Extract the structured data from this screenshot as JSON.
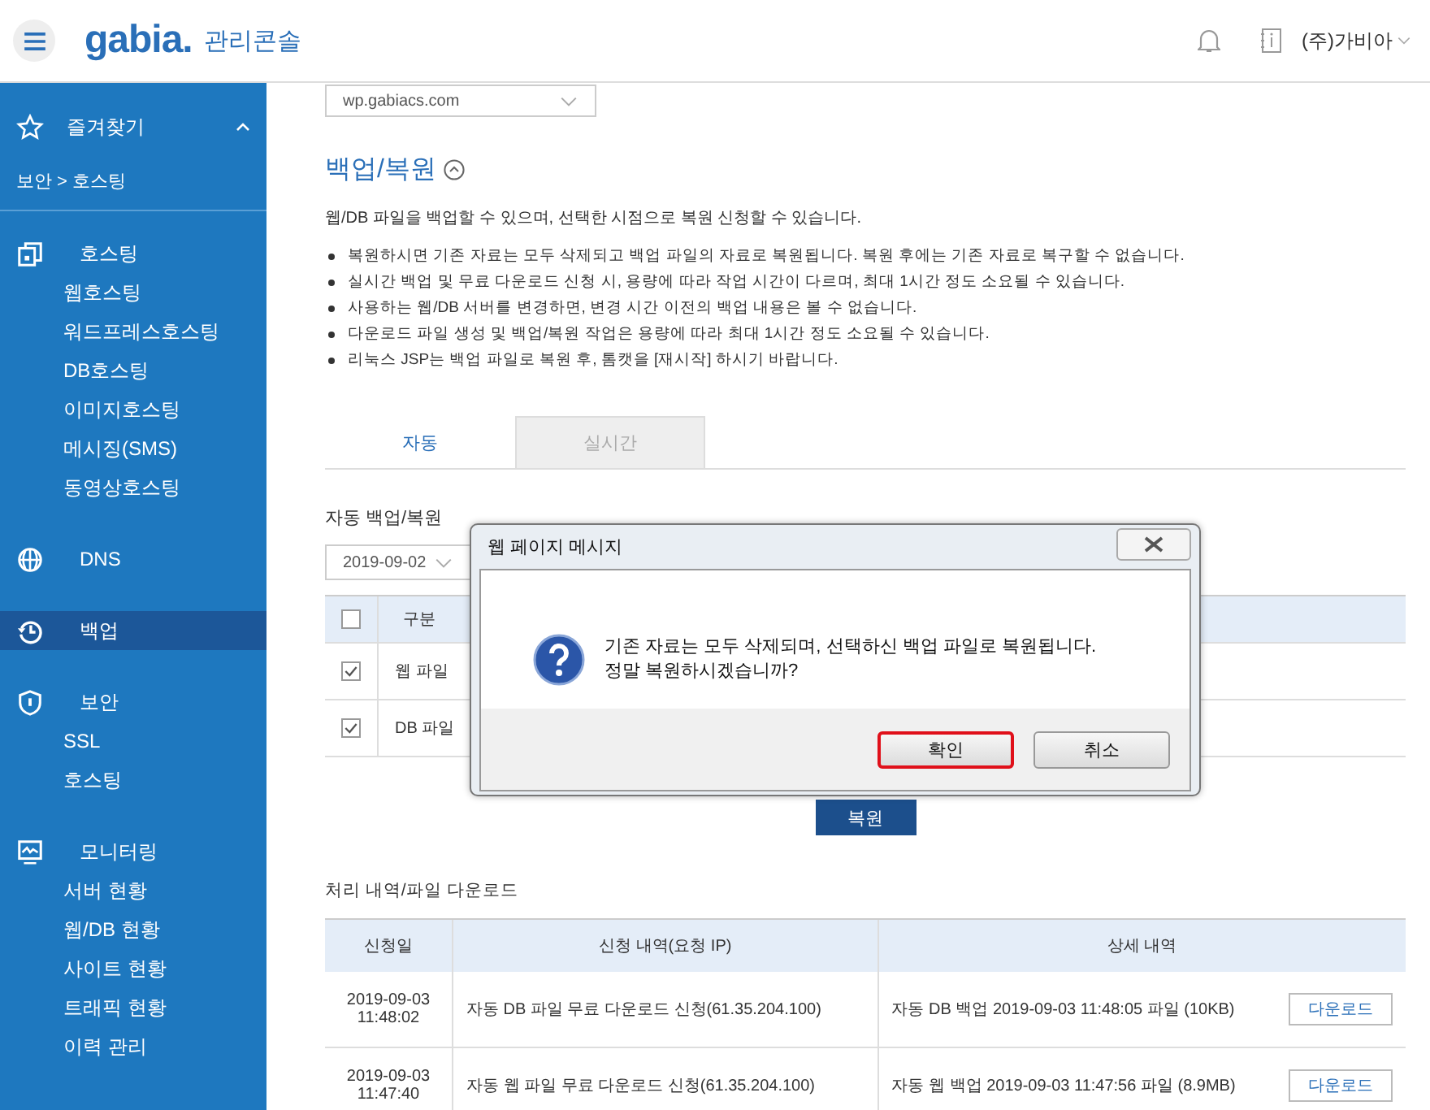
{
  "header": {
    "logo": "gabia.",
    "title": "관리콘솔",
    "account": "(주)가비아"
  },
  "sidebar": {
    "favorites": {
      "label": "즐겨찾기",
      "expanded": true
    },
    "breadcrumb": "보안 > 호스팅",
    "groups": [
      {
        "kind": "hosting",
        "label": "호스팅",
        "selected": false,
        "items": [
          "웹호스팅",
          "워드프레스호스팅",
          "DB호스팅",
          "이미지호스팅",
          "메시징(SMS)",
          "동영상호스팅"
        ]
      },
      {
        "kind": "dns",
        "label": "DNS",
        "selected": false
      },
      {
        "kind": "backup",
        "label": "백업",
        "selected": true
      },
      {
        "kind": "security",
        "label": "보안",
        "selected": false,
        "items": [
          "SSL",
          "호스팅"
        ]
      },
      {
        "kind": "monitoring",
        "label": "모니터링",
        "selected": false,
        "items": [
          "서버 현황",
          "웹/DB 현황",
          "사이트 현황",
          "트래픽 현황",
          "이력 관리"
        ]
      }
    ]
  },
  "main": {
    "domain_select": "wp.gabiacs.com",
    "title": "백업/복원",
    "intro": "웹/DB 파일을 백업할 수 있으며, 선택한 시점으로 복원 신청할 수 있습니다.",
    "notes": [
      "복원하시면 기존 자료는 모두 삭제되고 백업 파일의 자료로 복원됩니다. 복원 후에는 기존 자료로 복구할 수 없습니다.",
      "실시간 백업 및 무료 다운로드 신청 시, 용량에 따라 작업 시간이 다르며, 최대 1시간 정도 소요될 수 있습니다.",
      "사용하는 웹/DB 서버를 변경하면, 변경 시간 이전의 백업 내용은 볼 수 없습니다.",
      "다운로드 파일 생성 및 백업/복원 작업은 용량에 따라 최대 1시간 정도 소요될 수 있습니다.",
      "리눅스 JSP는 백업 파일로 복원 후, 톰캣을 [재시작] 하시기 바랍니다."
    ],
    "tabs": [
      {
        "label": "자동",
        "selected": true
      },
      {
        "label": "실시간",
        "selected": false
      }
    ],
    "auto_section": {
      "title": "자동 백업/복원",
      "date_select": "2019-09-02",
      "header_checked": false,
      "column": "구분",
      "rows": [
        {
          "label": "웹 파일",
          "checked": true
        },
        {
          "label": "DB 파일",
          "checked": true
        }
      ],
      "restore_button": "복원"
    },
    "history": {
      "title": "처리 내역/파일 다운로드",
      "columns": [
        "신청일",
        "신청 내역(요청 IP)",
        "상세 내역"
      ],
      "rows": [
        {
          "date": "2019-09-03 11:48:02",
          "request": "자동 DB 파일 무료 다운로드 신청(61.35.204.100)",
          "detail": "자동 DB 백업 2019-09-03 11:48:05 파일 (10KB)",
          "button": "다운로드"
        },
        {
          "date": "2019-09-03 11:47:40",
          "request": "자동 웹 파일 무료 다운로드 신청(61.35.204.100)",
          "detail": "자동 웹 백업 2019-09-03 11:47:56 파일 (8.9MB)",
          "button": "다운로드"
        }
      ]
    }
  },
  "dialog": {
    "title": "웹 페이지 메시지",
    "message": [
      "기존 자료는 모두 삭제되며, 선택하신 백업 파일로 복원됩니다.",
      "정말 복원하시겠습니까?"
    ],
    "buttons": [
      {
        "label": "확인",
        "focused": true
      },
      {
        "label": "취소",
        "focused": false
      }
    ]
  }
}
